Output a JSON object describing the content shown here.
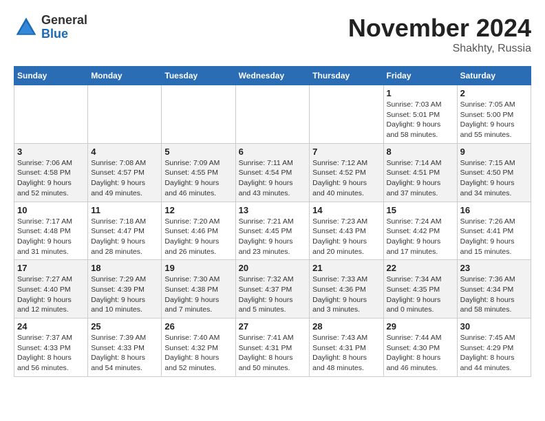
{
  "logo": {
    "general": "General",
    "blue": "Blue"
  },
  "header": {
    "month": "November 2024",
    "location": "Shakhty, Russia"
  },
  "weekdays": [
    "Sunday",
    "Monday",
    "Tuesday",
    "Wednesday",
    "Thursday",
    "Friday",
    "Saturday"
  ],
  "weeks": [
    [
      {
        "day": "",
        "info": ""
      },
      {
        "day": "",
        "info": ""
      },
      {
        "day": "",
        "info": ""
      },
      {
        "day": "",
        "info": ""
      },
      {
        "day": "",
        "info": ""
      },
      {
        "day": "1",
        "info": "Sunrise: 7:03 AM\nSunset: 5:01 PM\nDaylight: 9 hours and 58 minutes."
      },
      {
        "day": "2",
        "info": "Sunrise: 7:05 AM\nSunset: 5:00 PM\nDaylight: 9 hours and 55 minutes."
      }
    ],
    [
      {
        "day": "3",
        "info": "Sunrise: 7:06 AM\nSunset: 4:58 PM\nDaylight: 9 hours and 52 minutes."
      },
      {
        "day": "4",
        "info": "Sunrise: 7:08 AM\nSunset: 4:57 PM\nDaylight: 9 hours and 49 minutes."
      },
      {
        "day": "5",
        "info": "Sunrise: 7:09 AM\nSunset: 4:55 PM\nDaylight: 9 hours and 46 minutes."
      },
      {
        "day": "6",
        "info": "Sunrise: 7:11 AM\nSunset: 4:54 PM\nDaylight: 9 hours and 43 minutes."
      },
      {
        "day": "7",
        "info": "Sunrise: 7:12 AM\nSunset: 4:52 PM\nDaylight: 9 hours and 40 minutes."
      },
      {
        "day": "8",
        "info": "Sunrise: 7:14 AM\nSunset: 4:51 PM\nDaylight: 9 hours and 37 minutes."
      },
      {
        "day": "9",
        "info": "Sunrise: 7:15 AM\nSunset: 4:50 PM\nDaylight: 9 hours and 34 minutes."
      }
    ],
    [
      {
        "day": "10",
        "info": "Sunrise: 7:17 AM\nSunset: 4:48 PM\nDaylight: 9 hours and 31 minutes."
      },
      {
        "day": "11",
        "info": "Sunrise: 7:18 AM\nSunset: 4:47 PM\nDaylight: 9 hours and 28 minutes."
      },
      {
        "day": "12",
        "info": "Sunrise: 7:20 AM\nSunset: 4:46 PM\nDaylight: 9 hours and 26 minutes."
      },
      {
        "day": "13",
        "info": "Sunrise: 7:21 AM\nSunset: 4:45 PM\nDaylight: 9 hours and 23 minutes."
      },
      {
        "day": "14",
        "info": "Sunrise: 7:23 AM\nSunset: 4:43 PM\nDaylight: 9 hours and 20 minutes."
      },
      {
        "day": "15",
        "info": "Sunrise: 7:24 AM\nSunset: 4:42 PM\nDaylight: 9 hours and 17 minutes."
      },
      {
        "day": "16",
        "info": "Sunrise: 7:26 AM\nSunset: 4:41 PM\nDaylight: 9 hours and 15 minutes."
      }
    ],
    [
      {
        "day": "17",
        "info": "Sunrise: 7:27 AM\nSunset: 4:40 PM\nDaylight: 9 hours and 12 minutes."
      },
      {
        "day": "18",
        "info": "Sunrise: 7:29 AM\nSunset: 4:39 PM\nDaylight: 9 hours and 10 minutes."
      },
      {
        "day": "19",
        "info": "Sunrise: 7:30 AM\nSunset: 4:38 PM\nDaylight: 9 hours and 7 minutes."
      },
      {
        "day": "20",
        "info": "Sunrise: 7:32 AM\nSunset: 4:37 PM\nDaylight: 9 hours and 5 minutes."
      },
      {
        "day": "21",
        "info": "Sunrise: 7:33 AM\nSunset: 4:36 PM\nDaylight: 9 hours and 3 minutes."
      },
      {
        "day": "22",
        "info": "Sunrise: 7:34 AM\nSunset: 4:35 PM\nDaylight: 9 hours and 0 minutes."
      },
      {
        "day": "23",
        "info": "Sunrise: 7:36 AM\nSunset: 4:34 PM\nDaylight: 8 hours and 58 minutes."
      }
    ],
    [
      {
        "day": "24",
        "info": "Sunrise: 7:37 AM\nSunset: 4:33 PM\nDaylight: 8 hours and 56 minutes."
      },
      {
        "day": "25",
        "info": "Sunrise: 7:39 AM\nSunset: 4:33 PM\nDaylight: 8 hours and 54 minutes."
      },
      {
        "day": "26",
        "info": "Sunrise: 7:40 AM\nSunset: 4:32 PM\nDaylight: 8 hours and 52 minutes."
      },
      {
        "day": "27",
        "info": "Sunrise: 7:41 AM\nSunset: 4:31 PM\nDaylight: 8 hours and 50 minutes."
      },
      {
        "day": "28",
        "info": "Sunrise: 7:43 AM\nSunset: 4:31 PM\nDaylight: 8 hours and 48 minutes."
      },
      {
        "day": "29",
        "info": "Sunrise: 7:44 AM\nSunset: 4:30 PM\nDaylight: 8 hours and 46 minutes."
      },
      {
        "day": "30",
        "info": "Sunrise: 7:45 AM\nSunset: 4:29 PM\nDaylight: 8 hours and 44 minutes."
      }
    ]
  ]
}
